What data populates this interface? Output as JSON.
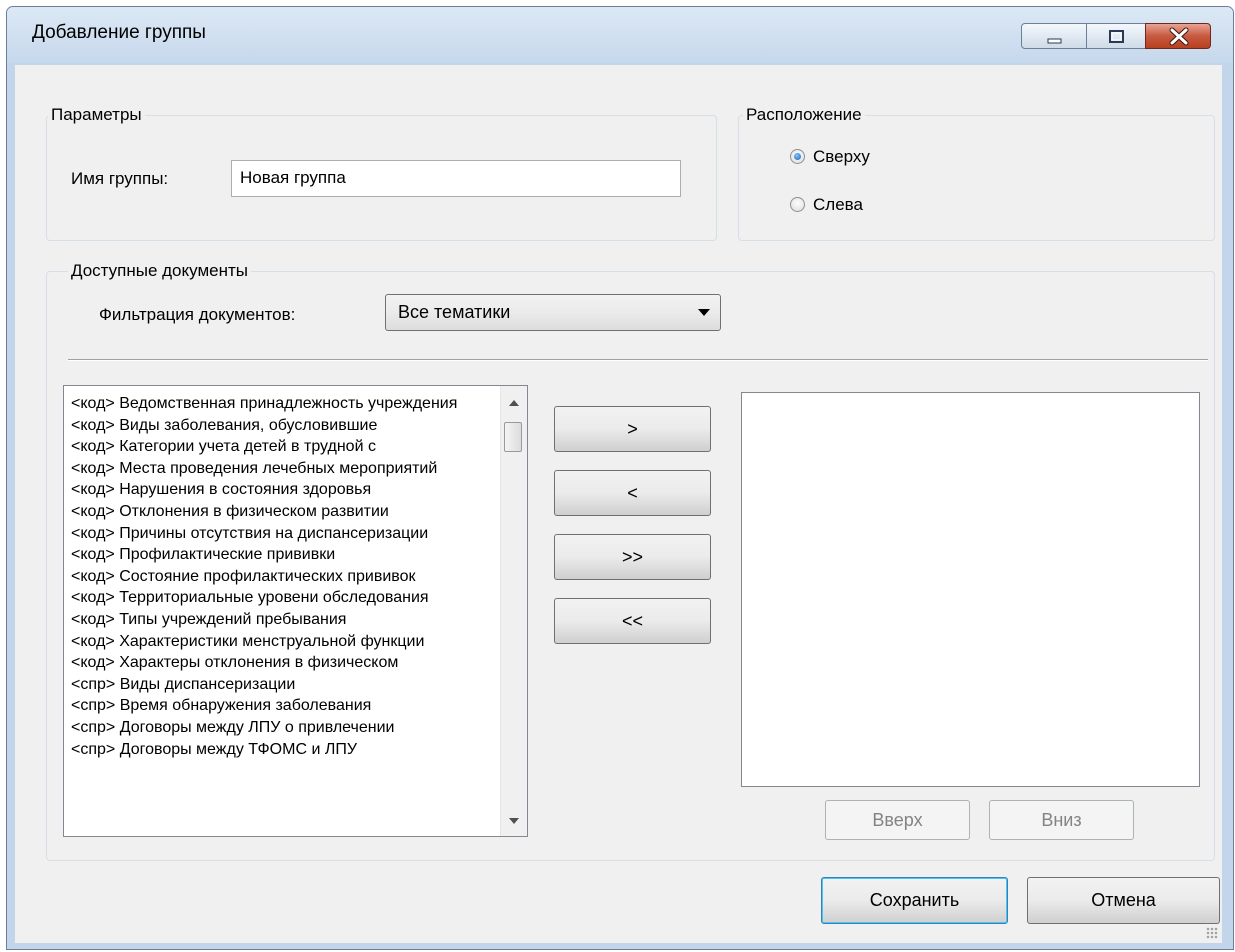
{
  "window": {
    "title": "Добавление группы"
  },
  "params": {
    "legend": "Параметры",
    "name_label": "Имя группы:",
    "name_value": "Новая группа"
  },
  "position": {
    "legend": "Расположение",
    "options": [
      {
        "label": "Сверху",
        "checked": true
      },
      {
        "label": "Слева",
        "checked": false
      }
    ]
  },
  "docs": {
    "legend": "Доступные документы",
    "filter_label": "Фильтрация документов:",
    "filter_value": "Все тематики",
    "available": [
      "<код> Ведомственная принадлежность учреждения",
      "<код> Виды заболевания, обусловившие",
      "<код> Категории учета детей в трудной с",
      "<код> Места проведения лечебных мероприятий",
      "<код> Нарушения в состояния здоровья",
      "<код> Отклонения в физическом развитии",
      "<код> Причины отсутствия на диспансеризации",
      "<код> Профилактические прививки",
      "<код> Состояние профилактических прививок",
      "<код> Территориальные уровени обследования",
      "<код> Типы учреждений пребывания",
      "<код> Характеристики менструальной функции",
      "<код> Характеры отклонения в физическом",
      "<спр> Виды диспансеризации",
      "<спр> Время обнаружения заболевания",
      "<спр> Договоры между ЛПУ о привлечении",
      "<спр> Договоры между ТФОМС и ЛПУ"
    ],
    "move_buttons": [
      ">",
      "<",
      ">>",
      "<<"
    ],
    "up_label": "Вверх",
    "down_label": "Вниз"
  },
  "footer": {
    "save_label": "Сохранить",
    "cancel_label": "Отмена"
  }
}
